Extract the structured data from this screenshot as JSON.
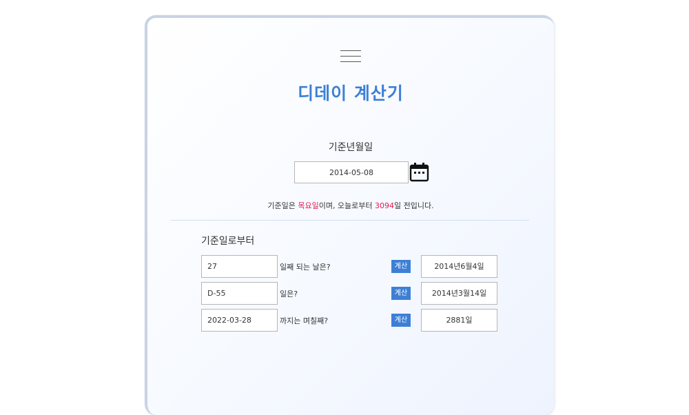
{
  "app": {
    "title": "디데이 계산기"
  },
  "base": {
    "label": "기준년월일",
    "date": "2014-05-08"
  },
  "info": {
    "prefix": "기준일은 ",
    "weekday": "목요일",
    "middle": "이며, 오늘로부터 ",
    "days": "3094",
    "suffix": "일 전입니다."
  },
  "section": {
    "label": "기준일로부터"
  },
  "rows": [
    {
      "value": "27",
      "desc": "일째 되는 날은?",
      "button": "계산",
      "result": "2014년6월4일"
    },
    {
      "value": "D-55",
      "desc": "일은?",
      "button": "계산",
      "result": "2014년3월14일"
    },
    {
      "value": "2022-03-28",
      "desc": "까지는 며칠째?",
      "button": "계산",
      "result": "2881일"
    }
  ],
  "colors": {
    "accent": "#3d7fd6",
    "highlight": "#e8174f"
  },
  "icons": {
    "menu": "hamburger-menu-icon",
    "calendar": "calendar-icon"
  }
}
